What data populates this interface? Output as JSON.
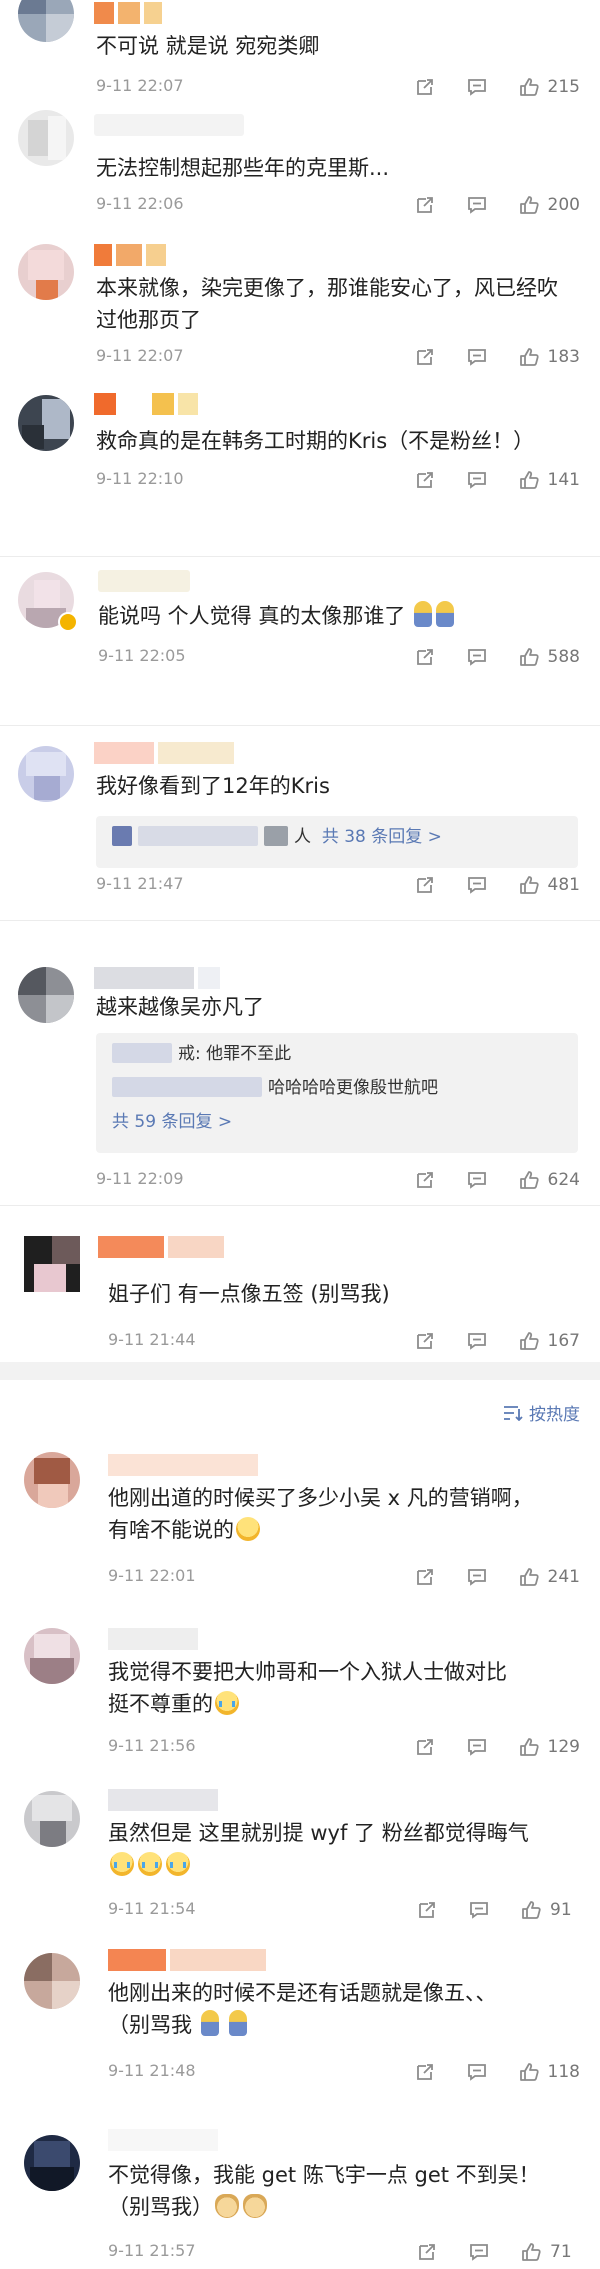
{
  "comments_top": [
    {
      "text": "不可说 就是说 宛宛类卿",
      "time": "9-11 22:07",
      "likes": "215"
    },
    {
      "text": "无法控制想起那些年的克里斯...",
      "time": "9-11 22:06",
      "likes": "200"
    },
    {
      "text": "本来就像，染完更像了，那谁能安心了，风已经吹\n过他那页了",
      "time": "9-11 22:07",
      "likes": "183"
    },
    {
      "text": "救命真的是在韩务工时期的Kris（不是粉丝！）",
      "time": "9-11 22:10",
      "likes": "141"
    },
    {
      "text": "能说吗 个人觉得 真的太像那谁了",
      "time": "9-11 22:05",
      "likes": "588"
    },
    {
      "text": "我好像看到了12年的Kris",
      "time": "9-11 21:47",
      "likes": "481",
      "reply_tail": "人",
      "reply_link": "共 38 条回复 >"
    },
    {
      "text": "越来越像吴亦凡了",
      "time": "9-11 22:09",
      "likes": "624",
      "reply1": "戒: 他罪不至此",
      "reply2": "哈哈哈哈更像殷世航吧",
      "reply_link": "共 59 条回复 >"
    },
    {
      "text": "姐子们 有一点像五签 (别骂我)",
      "time": "9-11 21:44",
      "likes": "167"
    }
  ],
  "sort_label": "按热度",
  "comments_bottom": [
    {
      "text": "他刚出道的时候买了多少小吴 x 凡的营销啊，\n有啥不能说的",
      "time": "9-11 22:01",
      "likes": "241"
    },
    {
      "text": "我觉得不要把大帅哥和一个入狱人士做对比\n挺不尊重的",
      "time": "9-11 21:56",
      "likes": "129"
    },
    {
      "text": "虽然但是 这里就别提 wyf 了 粉丝都觉得晦气",
      "time": "9-11 21:54",
      "likes": "91"
    },
    {
      "text": "他刚出来的时候不是还有话题就是像五、、\n（别骂我",
      "time": "9-11 21:48",
      "likes": "118"
    },
    {
      "text": "不觉得像，我能 get 陈飞宇一点 get 不到吴！\n（别骂我）",
      "time": "9-11 21:57",
      "likes": "71"
    }
  ],
  "icons": {
    "share": "share-icon",
    "comment": "comment-icon",
    "like": "thumbs-up-icon",
    "sort": "sort-icon"
  },
  "colors": {
    "link": "#5a79b4",
    "meta": "#9a9a9a",
    "reply_bg": "#f2f2f2"
  }
}
